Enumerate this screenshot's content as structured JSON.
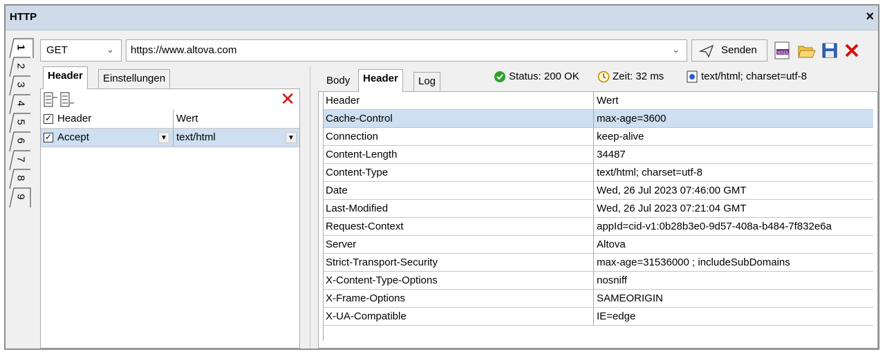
{
  "window": {
    "title": "HTTP",
    "close_glyph": "×"
  },
  "vertical_tabs": [
    "1",
    "2",
    "3",
    "4",
    "5",
    "6",
    "7",
    "8",
    "9"
  ],
  "request": {
    "method": "GET",
    "url": "https://www.altova.com",
    "send_label": "Senden"
  },
  "left_tabs": {
    "header": "Header",
    "settings": "Einstellungen"
  },
  "left_table": {
    "columns": [
      "Header",
      "Wert"
    ],
    "rows": [
      {
        "name": "Accept",
        "value": "text/html",
        "checked": true
      }
    ]
  },
  "right_tabs": {
    "body": "Body",
    "header": "Header",
    "log": "Log"
  },
  "status": {
    "status": "Status: 200 OK",
    "time": "Zeit: 32 ms",
    "content_type": "text/html; charset=utf-8"
  },
  "response_headers": {
    "columns": [
      "Header",
      "Wert"
    ],
    "rows": [
      [
        "Cache-Control",
        "max-age=3600"
      ],
      [
        "Connection",
        "keep-alive"
      ],
      [
        "Content-Length",
        "34487"
      ],
      [
        "Content-Type",
        "text/html; charset=utf-8"
      ],
      [
        "Date",
        "Wed, 26 Jul 2023 07:46:00 GMT"
      ],
      [
        "Last-Modified",
        "Wed, 26 Jul 2023 07:21:04 GMT"
      ],
      [
        "Request-Context",
        "appId=cid-v1:0b28b3e0-9d57-408a-b484-7f832e6a"
      ],
      [
        "Server",
        "Altova"
      ],
      [
        "Strict-Transport-Security",
        "max-age=31536000 ; includeSubDomains"
      ],
      [
        "X-Content-Type-Options",
        "nosniff"
      ],
      [
        "X-Frame-Options",
        "SAMEORIGIN"
      ],
      [
        "X-UA-Compatible",
        "IE=edge"
      ]
    ]
  },
  "colors": {
    "selection": "#cddff0",
    "titlebar": "#d0dbe9",
    "delete_red": "#d41111",
    "status_green": "#2ca02c"
  },
  "icons": [
    "send-icon",
    "wsdl-icon",
    "open-folder-icon",
    "save-icon",
    "delete-icon",
    "add-row-icon",
    "append-row-icon",
    "status-ok-icon",
    "clock-icon",
    "content-type-icon"
  ]
}
